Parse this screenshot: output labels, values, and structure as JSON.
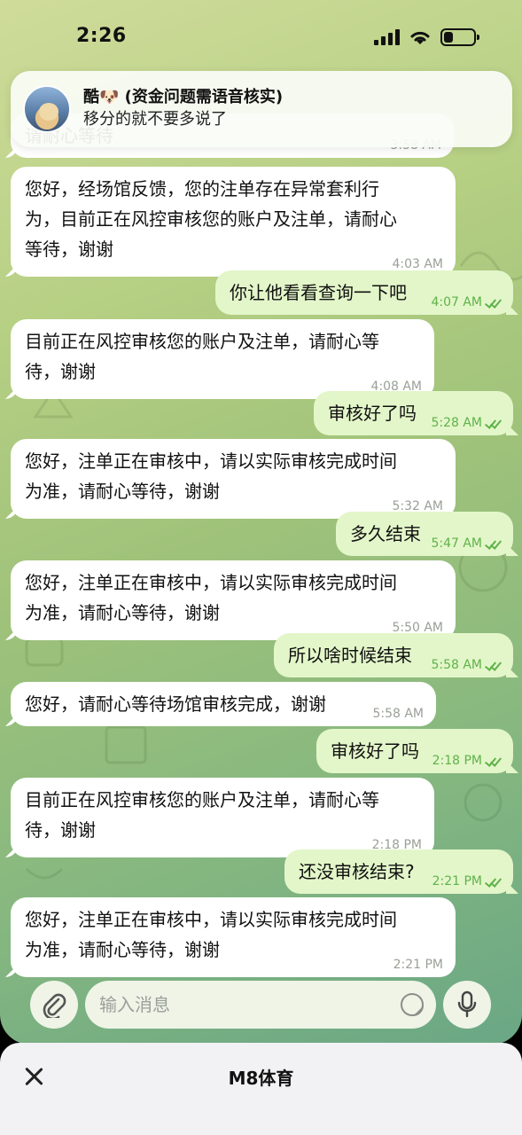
{
  "status_bar": {
    "time": "2:26",
    "battery_level": 0.3
  },
  "notification": {
    "title": "酷🐶 (资金问题需语音核实)",
    "body": "移分的就不要多说了"
  },
  "messages": [
    {
      "direction": "in",
      "lines": [
        "请耐心等待"
      ],
      "time": "3:58 AM"
    },
    {
      "direction": "in",
      "lines": [
        "您好，经场馆反馈，您的注单存在异常套利行",
        "为，目前正在风控审核您的账户及注单，请耐心",
        "等待，谢谢"
      ],
      "time": "4:03 AM"
    },
    {
      "direction": "out",
      "lines": [
        "你让他看看查询一下吧"
      ],
      "time": "4:07 AM"
    },
    {
      "direction": "in",
      "lines": [
        "目前正在风控审核您的账户及注单，请耐心等",
        "待，谢谢"
      ],
      "time": "4:08 AM"
    },
    {
      "direction": "out",
      "lines": [
        "审核好了吗"
      ],
      "time": "5:28 AM"
    },
    {
      "direction": "in",
      "lines": [
        "您好，注单正在审核中，请以实际审核完成时间",
        "为准，请耐心等待，谢谢"
      ],
      "time": "5:32 AM"
    },
    {
      "direction": "out",
      "lines": [
        "多久结束"
      ],
      "time": "5:47 AM"
    },
    {
      "direction": "in",
      "lines": [
        "您好，注单正在审核中，请以实际审核完成时间",
        "为准，请耐心等待，谢谢"
      ],
      "time": "5:50 AM"
    },
    {
      "direction": "out",
      "lines": [
        "所以啥时候结束"
      ],
      "time": "5:58 AM"
    },
    {
      "direction": "in",
      "lines": [
        "您好，请耐心等待场馆审核完成，谢谢"
      ],
      "time": "5:58 AM"
    },
    {
      "direction": "out",
      "lines": [
        "审核好了吗"
      ],
      "time": "2:18 PM"
    },
    {
      "direction": "in",
      "lines": [
        "目前正在风控审核您的账户及注单，请耐心等",
        "待，谢谢"
      ],
      "time": "2:18 PM"
    },
    {
      "direction": "out",
      "lines": [
        "还没审核结束?"
      ],
      "time": "2:21 PM"
    },
    {
      "direction": "in",
      "lines": [
        "您好，注单正在审核中，请以实际审核完成时间",
        "为准，请耐心等待，谢谢"
      ],
      "time": "2:21 PM"
    }
  ],
  "composer": {
    "placeholder": "输入消息",
    "attach_icon": "paperclip-icon",
    "sticker_icon": "sticker-icon",
    "mic_icon": "microphone-icon"
  },
  "sheet": {
    "title": "M8体育",
    "close_icon": "close-icon"
  }
}
